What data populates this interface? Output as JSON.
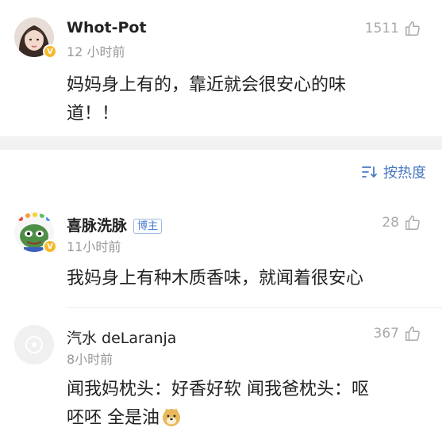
{
  "top_comment": {
    "username": "Whot-Pot",
    "time": "12 小时前",
    "likes": "1511",
    "content_line1": "妈妈身上有的，靠近就会很安心的味",
    "content_line2": "道！！"
  },
  "sort": {
    "label": "按热度",
    "icon": "sort-icon"
  },
  "comments": [
    {
      "username": "喜脉洗脉",
      "badge": "博主",
      "time": "11小时前",
      "likes": "28",
      "content": "我妈身上有种木质香味，就闻着很安心"
    },
    {
      "username": "汽水 deLaranja",
      "time": "8小时前",
      "likes": "367",
      "content_line1": "闻我妈枕头：好香好软  闻我爸枕头：呕",
      "content_line2": "呸呸  全是油"
    }
  ],
  "colors": {
    "link_blue": "#4a78c2",
    "verified": "#f6b92b",
    "band": "#f2f2f2"
  }
}
